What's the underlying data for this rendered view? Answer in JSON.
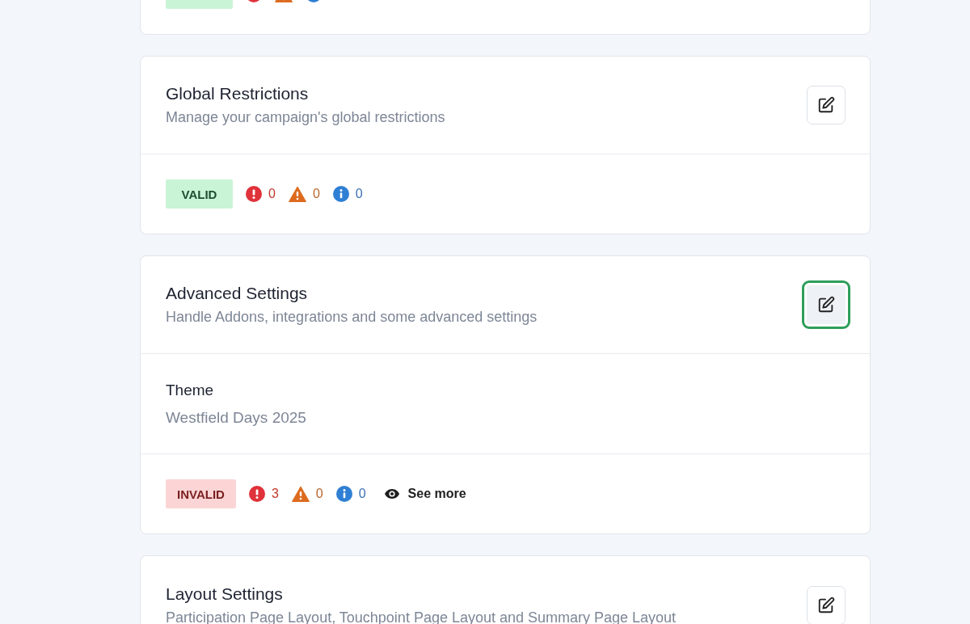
{
  "cards": [
    {
      "footer": {
        "status": {
          "kind": "valid"
        },
        "counts": [
          {
            "kind": "error"
          },
          {
            "kind": "warning"
          },
          {
            "kind": "info"
          }
        ]
      }
    },
    {
      "header": {
        "title": "Global Restrictions",
        "subtitle": "Manage your campaign's global restrictions",
        "edit_focused": false
      },
      "footer": {
        "status": {
          "kind": "valid",
          "label": "VALID"
        },
        "counts": [
          {
            "kind": "error",
            "value": "0"
          },
          {
            "kind": "warning",
            "value": "0"
          },
          {
            "kind": "info",
            "value": "0"
          }
        ]
      }
    },
    {
      "header": {
        "title": "Advanced Settings",
        "subtitle": "Handle Addons, integrations and some advanced settings",
        "edit_focused": true
      },
      "fields": [
        {
          "label": "Theme",
          "value": "Westfield Days 2025"
        }
      ],
      "footer": {
        "status": {
          "kind": "invalid",
          "label": "INVALID"
        },
        "counts": [
          {
            "kind": "error",
            "value": "3"
          },
          {
            "kind": "warning",
            "value": "0"
          },
          {
            "kind": "info",
            "value": "0"
          }
        ],
        "link": "See more"
      }
    },
    {
      "header": {
        "title": "Layout Settings",
        "subtitle": "Participation Page Layout, Touchpoint Page Layout and Summary Page Layout",
        "edit_focused": false
      }
    }
  ]
}
